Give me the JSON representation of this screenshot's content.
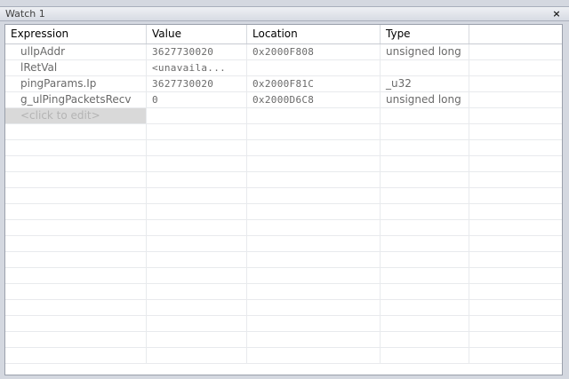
{
  "window": {
    "title": "Watch 1",
    "close_glyph": "×"
  },
  "columns": [
    "Expression",
    "Value",
    "Location",
    "Type"
  ],
  "rows": [
    {
      "expression": "ullpAddr",
      "value": "3627730020",
      "location": "0x2000F808",
      "type": "unsigned long"
    },
    {
      "expression": "lRetVal",
      "value": "<unavaila...",
      "location": "",
      "type": ""
    },
    {
      "expression": "pingParams.Ip",
      "value": "3627730020",
      "location": "0x2000F81C",
      "type": "_u32"
    },
    {
      "expression": "g_ulPingPacketsRecv",
      "value": "0",
      "location": "0x2000D6C8",
      "type": "unsigned long"
    }
  ],
  "edit_placeholder": "<click to edit>"
}
